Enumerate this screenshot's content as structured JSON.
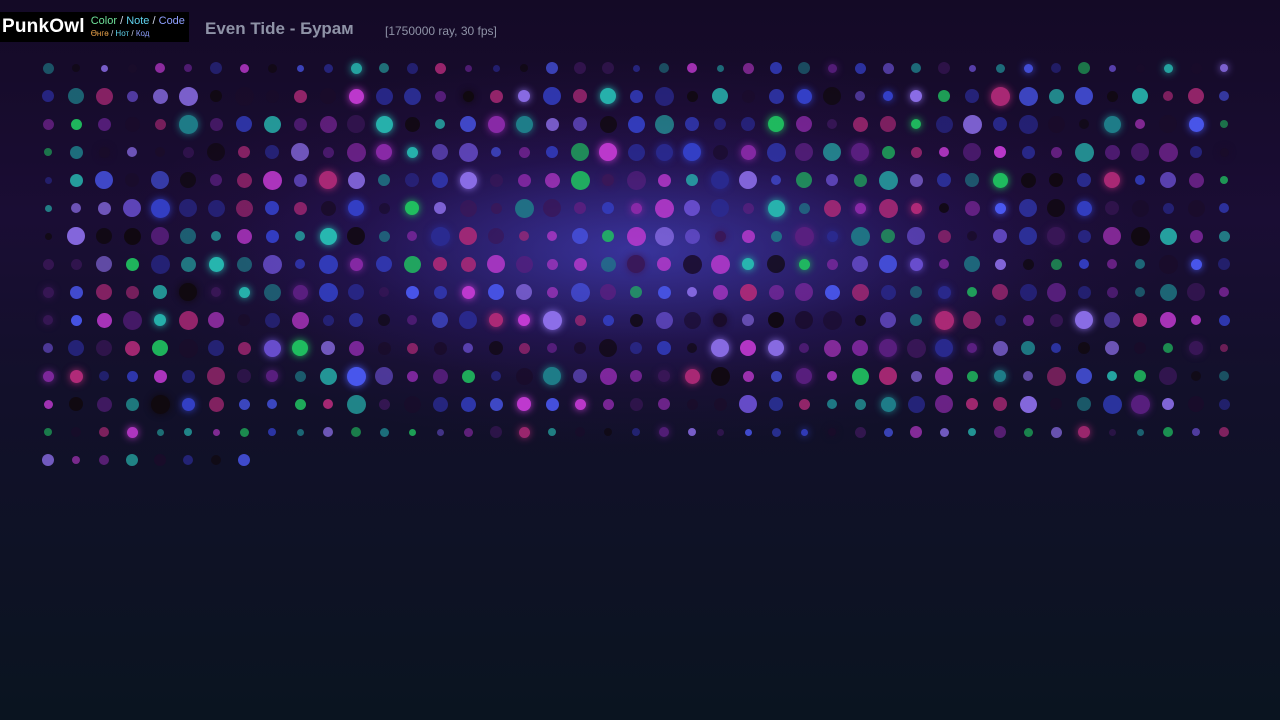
{
  "brand": {
    "name": "PunkOwl",
    "en": {
      "color": "Color",
      "note": "Note",
      "code": "Code",
      "sep": "/"
    },
    "ru": {
      "color": "Өнгө",
      "note": "Нот",
      "code": "Код",
      "sep": "/"
    }
  },
  "track": {
    "title": "Even Tide - Бурам",
    "stats": "[1750000 ray, 30 fps]"
  },
  "colors": {
    "background": "#12102a",
    "brand_green": "#6fe29a",
    "brand_cyan": "#5fd3ee",
    "brand_blue": "#8fa0ff",
    "brand_orange": "#e9a24a",
    "title_gray": "#8f93a7",
    "palette": [
      "#1a0c2a",
      "#3a1758",
      "#5a1f80",
      "#2a2a90",
      "#3440c8",
      "#4a58f0",
      "#1f7f8a",
      "#27b7b0",
      "#8a2aa8",
      "#c23ad2",
      "#b02a78",
      "#6a4fd0",
      "#8c6ee8",
      "#20c060",
      "#10090f"
    ]
  }
}
